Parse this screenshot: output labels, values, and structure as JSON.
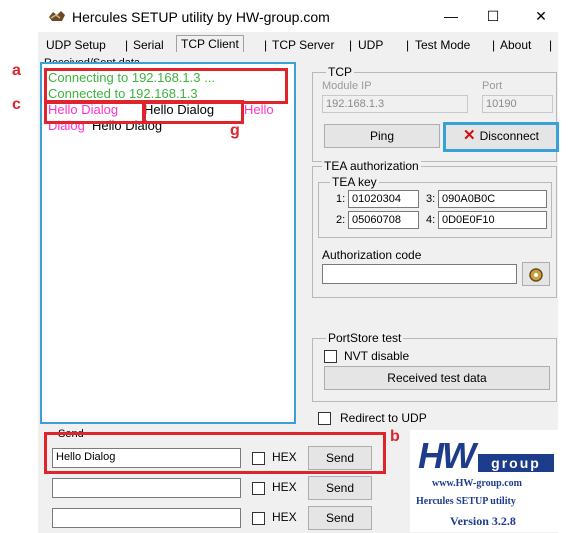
{
  "window": {
    "title": "Hercules SETUP utility by HW-group.com",
    "minimize": "—",
    "maximize": "☐",
    "close": "✕"
  },
  "tabs": [
    "UDP Setup",
    "Serial",
    "TCP Client",
    "TCP Server",
    "UDP",
    "Test Mode",
    "About"
  ],
  "active_tab": "TCP Client",
  "received": {
    "label": "Received/Sent data",
    "lines": {
      "l1": "Connecting to 192.168.1.3 ...",
      "l2": "Connected to 192.168.1.3",
      "l3a": "Hello Dialog",
      "l3b": "Hello Dialog",
      "l3c": "Hello",
      "l4a": "Dialog",
      "l4b": "Hello Dialog"
    }
  },
  "tcp": {
    "label": "TCP",
    "module_ip_label": "Module IP",
    "port_label": "Port",
    "module_ip": "192.168.1.3",
    "port": "10190",
    "ping_label": "Ping",
    "disconnect_label": "Disconnect"
  },
  "tea": {
    "label": "TEA authorization",
    "key_label": "TEA key",
    "k1_label": "1:",
    "k1": "01020304",
    "k2_label": "2:",
    "k2": "05060708",
    "k3_label": "3:",
    "k3": "090A0B0C",
    "k4_label": "4:",
    "k4": "0D0E0F10",
    "auth_label": "Authorization code",
    "auth_value": ""
  },
  "portstore": {
    "label": "PortStore test",
    "nvt_label": "NVT disable",
    "received_test_label": "Received test data"
  },
  "redirect_label": "Redirect to UDP",
  "send": {
    "label": "Send",
    "rows": [
      {
        "value": "Hello Dialog",
        "hex_label": "HEX",
        "send_label": "Send"
      },
      {
        "value": "",
        "hex_label": "HEX",
        "send_label": "Send"
      },
      {
        "value": "",
        "hex_label": "HEX",
        "send_label": "Send"
      }
    ]
  },
  "logo": {
    "brand": "HW",
    "group": "group",
    "url": "www.HW-group.com",
    "product": "Hercules SETUP utility",
    "version": "Version  3.2.8"
  },
  "annotations": {
    "a": "a",
    "b": "b",
    "c": "c",
    "g": "g"
  },
  "colors": {
    "green": "#3cb43c",
    "magenta": "#ff33cc",
    "annotation_red": "#e0242c",
    "focus_blue": "#3aa0d8",
    "logo_blue": "#1e3c8c"
  }
}
